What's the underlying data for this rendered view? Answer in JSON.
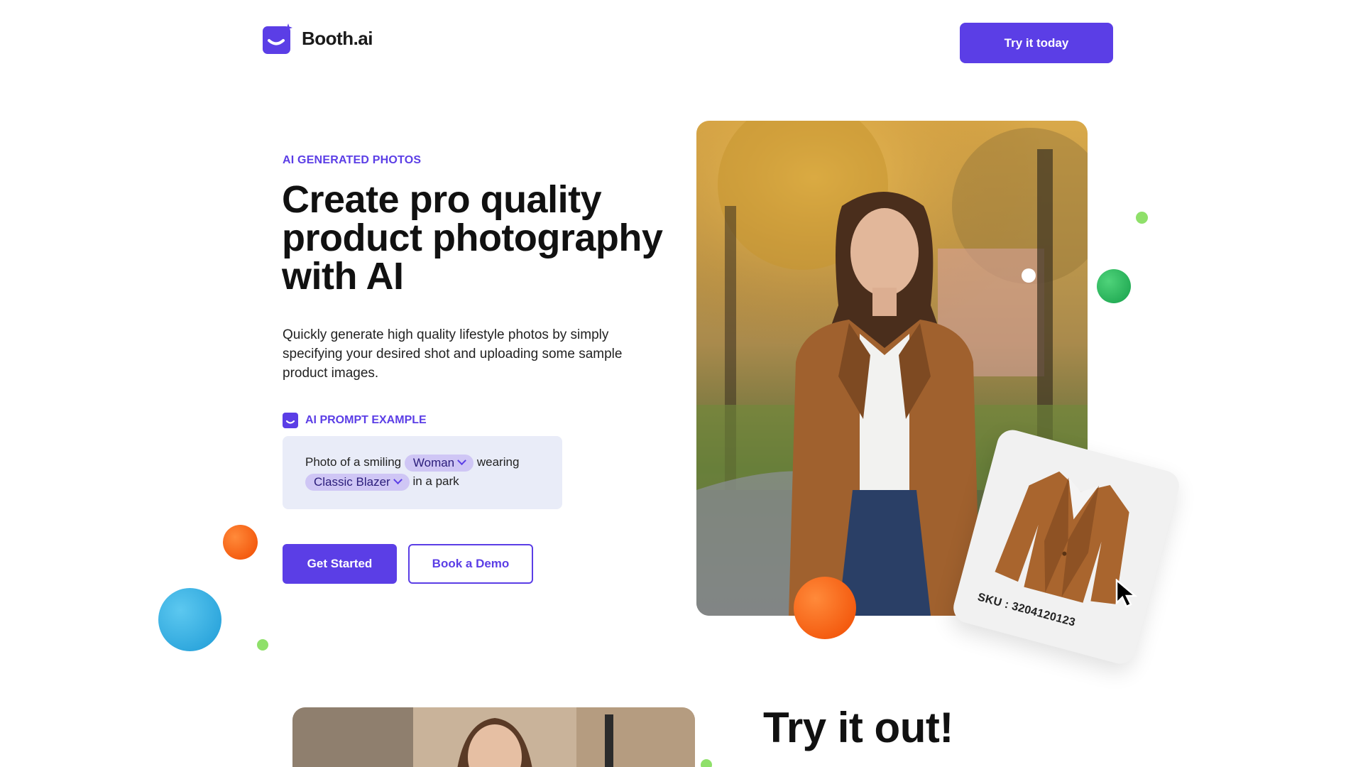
{
  "brand": {
    "name": "Booth.ai",
    "accent": "#5b3ee6"
  },
  "header": {
    "cta_label": "Try it today"
  },
  "hero": {
    "eyebrow": "AI GENERATED PHOTOS",
    "headline": "Create pro quality product photography with AI",
    "description": "Quickly generate high quality lifestyle photos by simply specifying your desired shot and uploading some sample product images.",
    "prompt_label": "AI PROMPT EXAMPLE",
    "prompt": {
      "part1": "Photo of a smiling",
      "chip1": "Woman",
      "part2": "wearing",
      "chip2": "Classic Blazer",
      "part3": "in a park"
    },
    "primary_button": "Get Started",
    "secondary_button": "Book a Demo"
  },
  "product_card": {
    "sku": "SKU : 3204120123"
  },
  "section2": {
    "heading": "Try it out!"
  },
  "colors": {
    "green": "#2fbf5b",
    "light_green": "#8fe06a",
    "orange": "#ff5a0a",
    "blue": "#2aa9e0"
  }
}
